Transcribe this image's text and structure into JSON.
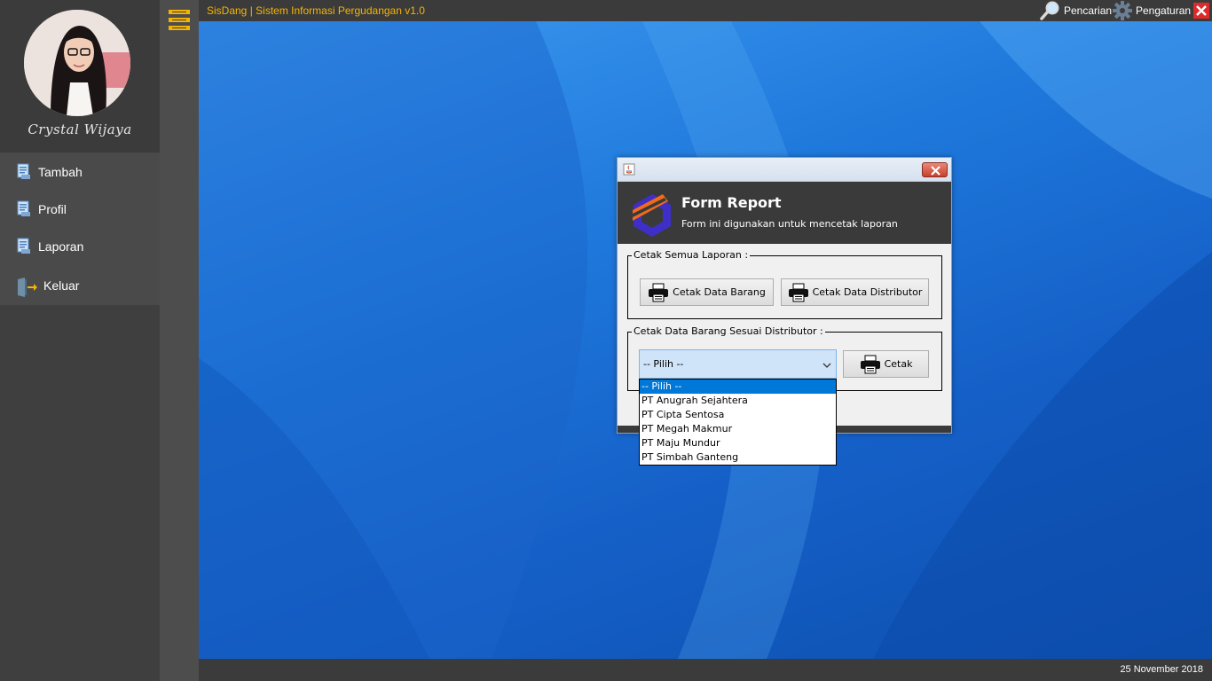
{
  "user": {
    "name": "Crystal Wijaya"
  },
  "sidebar": {
    "items": [
      {
        "label": "Tambah",
        "icon": "document-icon"
      },
      {
        "label": "Profil",
        "icon": "document-icon"
      },
      {
        "label": "Laporan",
        "icon": "document-icon"
      },
      {
        "label": "Keluar",
        "icon": "exit-door-icon"
      }
    ]
  },
  "topbar": {
    "title": "SisDang | Sistem Informasi Pergudangan v1.0",
    "search_label": "Pencarian",
    "settings_label": "Pengaturan"
  },
  "statusbar": {
    "date": "25 November 2018"
  },
  "dialog": {
    "title": "Form Report",
    "subtitle": "Form ini digunakan untuk mencetak laporan",
    "group_all": {
      "title": "Cetak Semua Laporan :",
      "btn_barang": "Cetak Data Barang",
      "btn_distributor": "Cetak Data Distributor"
    },
    "group_distributor": {
      "title": "Cetak Data Barang Sesuai Distributor :",
      "selected": "-- Pilih --",
      "btn_cetak": "Cetak"
    }
  },
  "dropdown": {
    "options": [
      "-- Pilih --",
      "PT Anugrah Sejahtera",
      "PT Cipta Sentosa",
      "PT Megah Makmur",
      "PT Maju Mundur",
      "PT Simbah Ganteng"
    ],
    "selected_index": 0
  },
  "colors": {
    "accent": "#f4b400",
    "selection": "#0078d7",
    "close_red": "#e0292b",
    "desktop_blue": "#1f79dc"
  }
}
